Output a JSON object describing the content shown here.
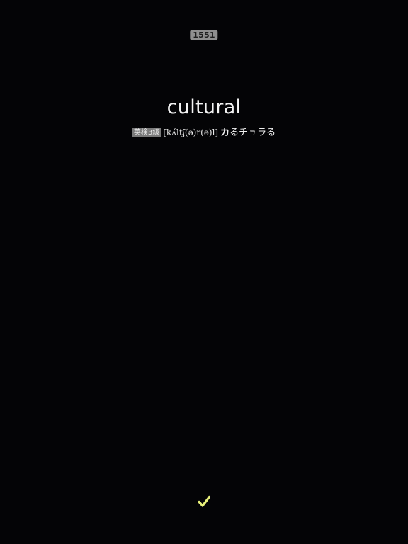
{
  "counter": "1551",
  "word": "cultural",
  "level_badge": "英検3級",
  "pronunciation": "[kʌ́ltʃ(ə)r(ə)l]",
  "katakana_stressed": "カ",
  "katakana_rest": "るチュラる",
  "check_icon": "checkmark-icon",
  "colors": {
    "background": "#040406",
    "check": "#e9f17a",
    "badge": "#8f8f8f"
  }
}
